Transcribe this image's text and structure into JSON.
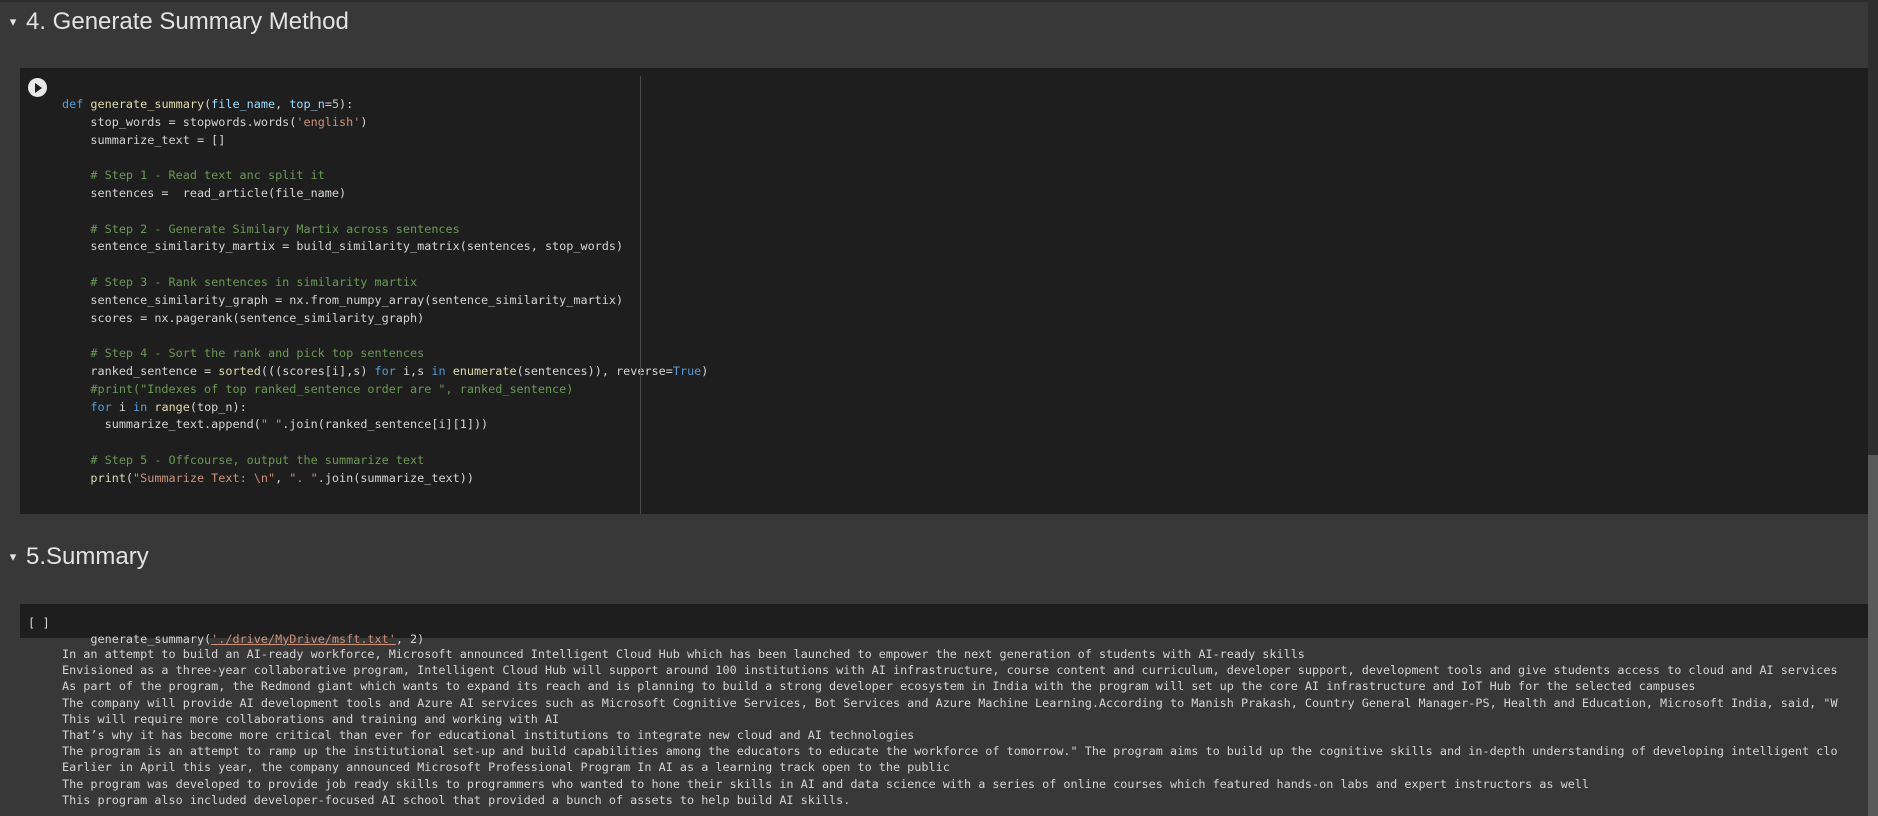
{
  "sections": [
    {
      "title": "4. Generate Summary Method"
    },
    {
      "title": "5.Summary"
    }
  ],
  "cell1": {
    "bracket": "",
    "lines": [
      [
        [
          "kw",
          "def "
        ],
        [
          "fn",
          "generate_summary"
        ],
        [
          "",
          "("
        ],
        [
          "prm",
          "file_name"
        ],
        [
          "",
          ", "
        ],
        [
          "prm",
          "top_n"
        ],
        [
          "",
          "="
        ],
        [
          "num",
          "5"
        ],
        [
          "",
          "):"
        ]
      ],
      [
        [
          "",
          "    stop_words = stopwords.words("
        ],
        [
          "str",
          "'english'"
        ],
        [
          "",
          ")"
        ]
      ],
      [
        [
          "",
          "    summarize_text = []"
        ]
      ],
      [
        [
          "",
          ""
        ]
      ],
      [
        [
          "cm",
          "    # Step 1 - Read text anc split it"
        ]
      ],
      [
        [
          "",
          "    sentences =  read_article(file_name)"
        ]
      ],
      [
        [
          "",
          ""
        ]
      ],
      [
        [
          "cm",
          "    # Step 2 - Generate Similary Martix across sentences"
        ]
      ],
      [
        [
          "",
          "    sentence_similarity_martix = build_similarity_matrix(sentences, stop_words)"
        ]
      ],
      [
        [
          "",
          ""
        ]
      ],
      [
        [
          "cm",
          "    # Step 3 - Rank sentences in similarity martix"
        ]
      ],
      [
        [
          "",
          "    sentence_similarity_graph = nx.from_numpy_array(sentence_similarity_martix)"
        ]
      ],
      [
        [
          "",
          "    scores = nx.pagerank(sentence_similarity_graph)"
        ]
      ],
      [
        [
          "",
          ""
        ]
      ],
      [
        [
          "cm",
          "    # Step 4 - Sort the rank and pick top sentences"
        ]
      ],
      [
        [
          "",
          "    ranked_sentence = "
        ],
        [
          "fn",
          "sorted"
        ],
        [
          "",
          "(((scores[i],s) "
        ],
        [
          "kw",
          "for"
        ],
        [
          "",
          " i,s "
        ],
        [
          "kw",
          "in"
        ],
        [
          "",
          " "
        ],
        [
          "fn",
          "enumerate"
        ],
        [
          "",
          "(sentences)), reverse="
        ],
        [
          "bool",
          "True"
        ],
        [
          "",
          ")"
        ]
      ],
      [
        [
          "cm",
          "    #print(\"Indexes of top ranked_sentence order are \", ranked_sentence)"
        ]
      ],
      [
        [
          "kw",
          "    for"
        ],
        [
          "",
          " i "
        ],
        [
          "kw",
          "in"
        ],
        [
          "",
          " "
        ],
        [
          "fn",
          "range"
        ],
        [
          "",
          "(top_n):"
        ]
      ],
      [
        [
          "",
          "      summarize_text.append("
        ],
        [
          "str",
          "\" \""
        ],
        [
          "",
          ".join(ranked_sentence[i][1]))"
        ]
      ],
      [
        [
          "",
          ""
        ]
      ],
      [
        [
          "cm",
          "    # Step 5 - Offcourse, output the summarize text"
        ]
      ],
      [
        [
          "fn",
          "    print"
        ],
        [
          "",
          "("
        ],
        [
          "str",
          "\"Summarize Text: \\n\""
        ],
        [
          "",
          ", "
        ],
        [
          "str",
          "\". \""
        ],
        [
          "",
          ".join(summarize_text))"
        ]
      ]
    ]
  },
  "cell2": {
    "bracket": "[ ]",
    "code_prefix": "generate_summary(",
    "code_path": "'./drive/MyDrive/msft.txt'",
    "code_suffix": ", 2)",
    "output_lines": [
      "In an attempt to build an AI-ready workforce, Microsoft announced Intelligent Cloud Hub which has been launched to empower the next generation of students with AI-ready skills",
      "Envisioned as a three-year collaborative program, Intelligent Cloud Hub will support around 100 institutions with AI infrastructure, course content and curriculum, developer support, development tools and give students access to cloud and AI services",
      "As part of the program, the Redmond giant which wants to expand its reach and is planning to build a strong developer ecosystem in India with the program will set up the core AI infrastructure and IoT Hub for the selected campuses",
      "The company will provide AI development tools and Azure AI services such as Microsoft Cognitive Services, Bot Services and Azure Machine Learning.According to Manish Prakash, Country General Manager-PS, Health and Education, Microsoft India, said, \"W",
      "This will require more collaborations and training and working with AI",
      "That’s why it has become more critical than ever for educational institutions to integrate new cloud and AI technologies",
      "The program is an attempt to ramp up the institutional set-up and build capabilities among the educators to educate the workforce of tomorrow.\" The program aims to build up the cognitive skills and in-depth understanding of developing intelligent clo",
      "Earlier in April this year, the company announced Microsoft Professional Program In AI as a learning track open to the public",
      "The program was developed to provide job ready skills to programmers who wanted to hone their skills in AI and data science with a series of online courses which featured hands-on labs and expert instructors as well",
      "This program also included developer-focused AI school that provided a bunch of assets to help build AI skills."
    ]
  }
}
